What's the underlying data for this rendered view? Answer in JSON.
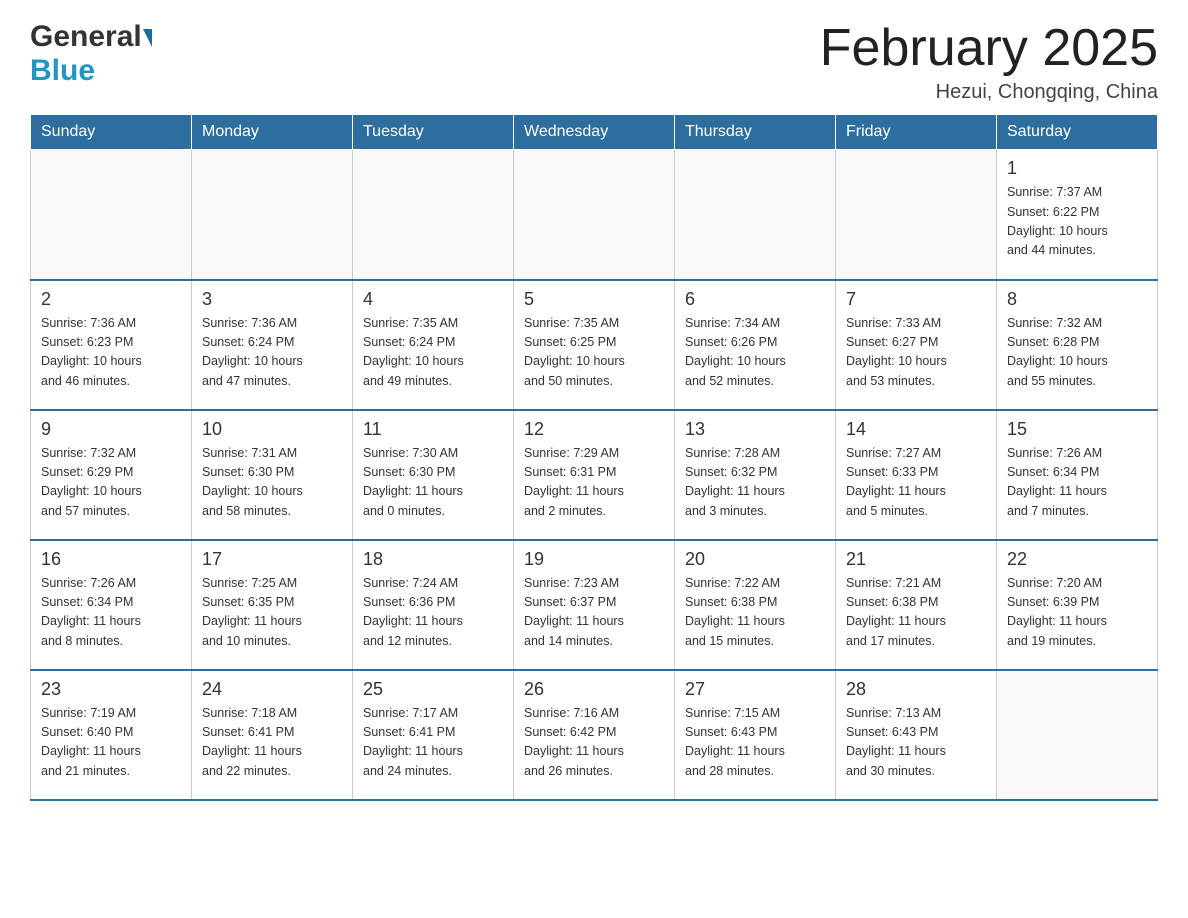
{
  "header": {
    "logo_general": "General",
    "logo_blue": "Blue",
    "month_title": "February 2025",
    "location": "Hezui, Chongqing, China"
  },
  "days_of_week": [
    "Sunday",
    "Monday",
    "Tuesday",
    "Wednesday",
    "Thursday",
    "Friday",
    "Saturday"
  ],
  "weeks": [
    {
      "cells": [
        {
          "day": "",
          "info": ""
        },
        {
          "day": "",
          "info": ""
        },
        {
          "day": "",
          "info": ""
        },
        {
          "day": "",
          "info": ""
        },
        {
          "day": "",
          "info": ""
        },
        {
          "day": "",
          "info": ""
        },
        {
          "day": "1",
          "info": "Sunrise: 7:37 AM\nSunset: 6:22 PM\nDaylight: 10 hours\nand 44 minutes."
        }
      ]
    },
    {
      "cells": [
        {
          "day": "2",
          "info": "Sunrise: 7:36 AM\nSunset: 6:23 PM\nDaylight: 10 hours\nand 46 minutes."
        },
        {
          "day": "3",
          "info": "Sunrise: 7:36 AM\nSunset: 6:24 PM\nDaylight: 10 hours\nand 47 minutes."
        },
        {
          "day": "4",
          "info": "Sunrise: 7:35 AM\nSunset: 6:24 PM\nDaylight: 10 hours\nand 49 minutes."
        },
        {
          "day": "5",
          "info": "Sunrise: 7:35 AM\nSunset: 6:25 PM\nDaylight: 10 hours\nand 50 minutes."
        },
        {
          "day": "6",
          "info": "Sunrise: 7:34 AM\nSunset: 6:26 PM\nDaylight: 10 hours\nand 52 minutes."
        },
        {
          "day": "7",
          "info": "Sunrise: 7:33 AM\nSunset: 6:27 PM\nDaylight: 10 hours\nand 53 minutes."
        },
        {
          "day": "8",
          "info": "Sunrise: 7:32 AM\nSunset: 6:28 PM\nDaylight: 10 hours\nand 55 minutes."
        }
      ]
    },
    {
      "cells": [
        {
          "day": "9",
          "info": "Sunrise: 7:32 AM\nSunset: 6:29 PM\nDaylight: 10 hours\nand 57 minutes."
        },
        {
          "day": "10",
          "info": "Sunrise: 7:31 AM\nSunset: 6:30 PM\nDaylight: 10 hours\nand 58 minutes."
        },
        {
          "day": "11",
          "info": "Sunrise: 7:30 AM\nSunset: 6:30 PM\nDaylight: 11 hours\nand 0 minutes."
        },
        {
          "day": "12",
          "info": "Sunrise: 7:29 AM\nSunset: 6:31 PM\nDaylight: 11 hours\nand 2 minutes."
        },
        {
          "day": "13",
          "info": "Sunrise: 7:28 AM\nSunset: 6:32 PM\nDaylight: 11 hours\nand 3 minutes."
        },
        {
          "day": "14",
          "info": "Sunrise: 7:27 AM\nSunset: 6:33 PM\nDaylight: 11 hours\nand 5 minutes."
        },
        {
          "day": "15",
          "info": "Sunrise: 7:26 AM\nSunset: 6:34 PM\nDaylight: 11 hours\nand 7 minutes."
        }
      ]
    },
    {
      "cells": [
        {
          "day": "16",
          "info": "Sunrise: 7:26 AM\nSunset: 6:34 PM\nDaylight: 11 hours\nand 8 minutes."
        },
        {
          "day": "17",
          "info": "Sunrise: 7:25 AM\nSunset: 6:35 PM\nDaylight: 11 hours\nand 10 minutes."
        },
        {
          "day": "18",
          "info": "Sunrise: 7:24 AM\nSunset: 6:36 PM\nDaylight: 11 hours\nand 12 minutes."
        },
        {
          "day": "19",
          "info": "Sunrise: 7:23 AM\nSunset: 6:37 PM\nDaylight: 11 hours\nand 14 minutes."
        },
        {
          "day": "20",
          "info": "Sunrise: 7:22 AM\nSunset: 6:38 PM\nDaylight: 11 hours\nand 15 minutes."
        },
        {
          "day": "21",
          "info": "Sunrise: 7:21 AM\nSunset: 6:38 PM\nDaylight: 11 hours\nand 17 minutes."
        },
        {
          "day": "22",
          "info": "Sunrise: 7:20 AM\nSunset: 6:39 PM\nDaylight: 11 hours\nand 19 minutes."
        }
      ]
    },
    {
      "cells": [
        {
          "day": "23",
          "info": "Sunrise: 7:19 AM\nSunset: 6:40 PM\nDaylight: 11 hours\nand 21 minutes."
        },
        {
          "day": "24",
          "info": "Sunrise: 7:18 AM\nSunset: 6:41 PM\nDaylight: 11 hours\nand 22 minutes."
        },
        {
          "day": "25",
          "info": "Sunrise: 7:17 AM\nSunset: 6:41 PM\nDaylight: 11 hours\nand 24 minutes."
        },
        {
          "day": "26",
          "info": "Sunrise: 7:16 AM\nSunset: 6:42 PM\nDaylight: 11 hours\nand 26 minutes."
        },
        {
          "day": "27",
          "info": "Sunrise: 7:15 AM\nSunset: 6:43 PM\nDaylight: 11 hours\nand 28 minutes."
        },
        {
          "day": "28",
          "info": "Sunrise: 7:13 AM\nSunset: 6:43 PM\nDaylight: 11 hours\nand 30 minutes."
        },
        {
          "day": "",
          "info": ""
        }
      ]
    }
  ]
}
